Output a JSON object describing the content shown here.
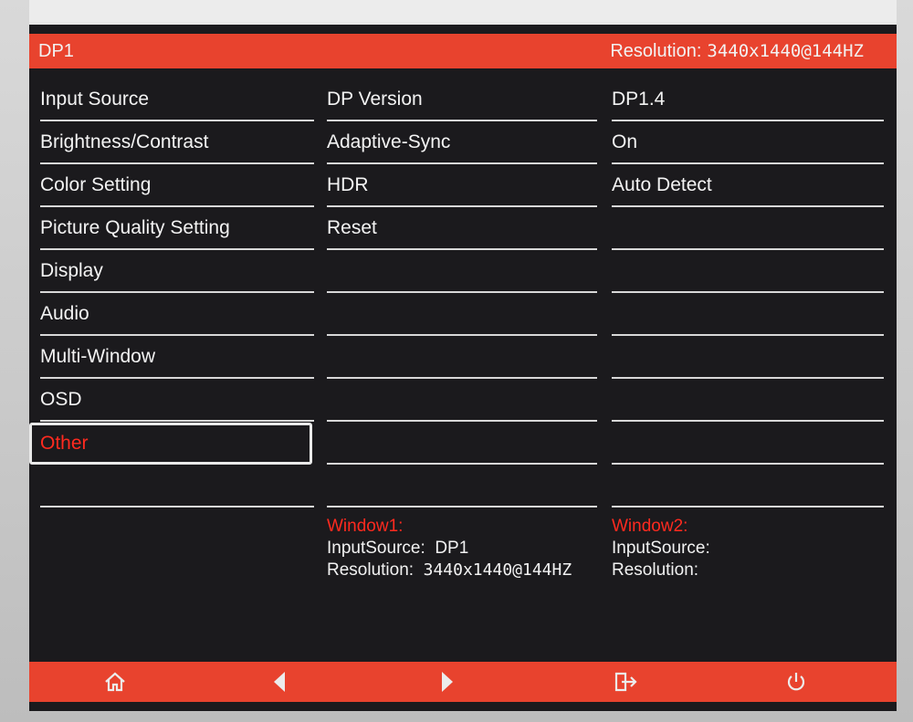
{
  "header": {
    "input_label": "DP1",
    "resolution_label": "Resolution:",
    "resolution_value": "3440x1440@144HZ"
  },
  "menu": {
    "items": [
      {
        "label": "Input Source"
      },
      {
        "label": "Brightness/Contrast"
      },
      {
        "label": "Color Setting"
      },
      {
        "label": "Picture Quality Setting"
      },
      {
        "label": "Display"
      },
      {
        "label": "Audio"
      },
      {
        "label": "Multi-Window"
      },
      {
        "label": "OSD"
      },
      {
        "label": "Other",
        "selected": true
      }
    ]
  },
  "submenu": {
    "items": [
      {
        "label": "DP Version",
        "value": "DP1.4"
      },
      {
        "label": "Adaptive-Sync",
        "value": "On"
      },
      {
        "label": "HDR",
        "value": "Auto Detect"
      },
      {
        "label": "Reset",
        "value": ""
      }
    ]
  },
  "window1": {
    "title": "Window1:",
    "input_label": "InputSource:",
    "input_value": "DP1",
    "resolution_label": "Resolution:",
    "resolution_value": "3440x1440@144HZ"
  },
  "window2": {
    "title": "Window2:",
    "input_label": "InputSource:",
    "input_value": "",
    "resolution_label": "Resolution:",
    "resolution_value": ""
  },
  "footer": {
    "buttons": [
      {
        "icon": "home-icon"
      },
      {
        "icon": "arrow-left-icon"
      },
      {
        "icon": "arrow-right-icon"
      },
      {
        "icon": "exit-icon"
      },
      {
        "icon": "power-icon"
      }
    ]
  },
  "colors": {
    "accent": "#e8432e",
    "highlight_text": "#ff2a1f",
    "background": "#1b1a1d",
    "text": "#f3f3f3"
  }
}
